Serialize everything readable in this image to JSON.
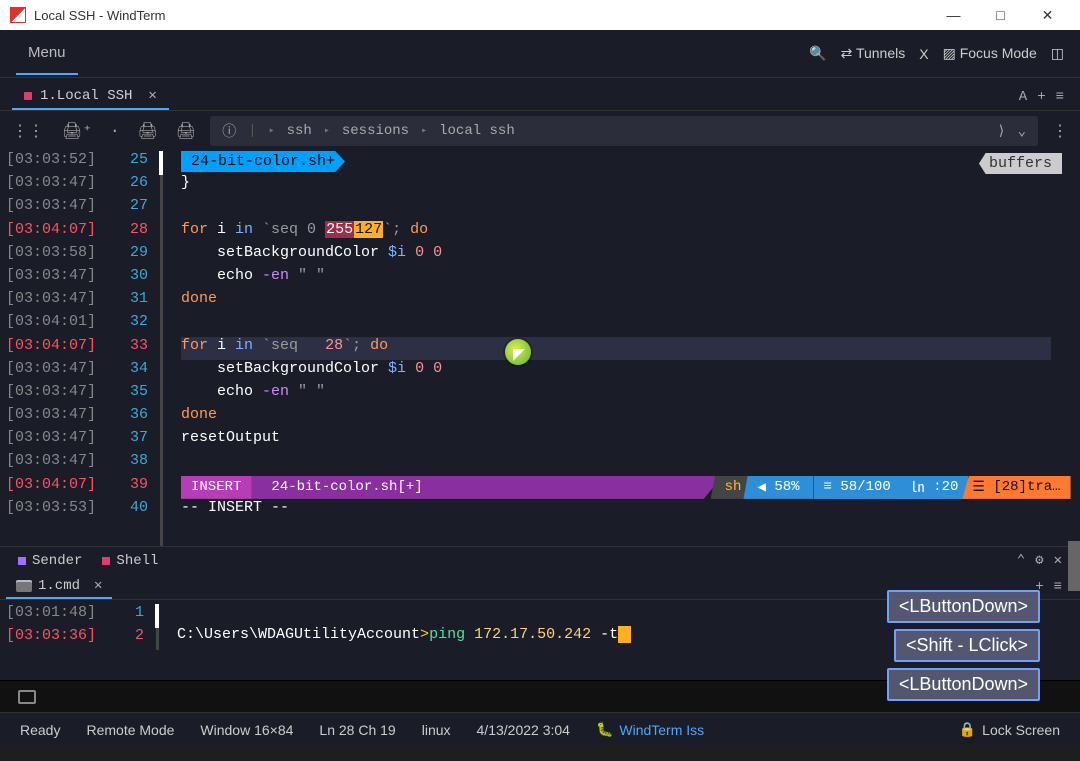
{
  "window": {
    "title": "Local SSH - WindTerm"
  },
  "menu": {
    "label": "Menu",
    "tunnels": "Tunnels",
    "x": "X",
    "focus": "Focus Mode"
  },
  "tab": {
    "label": "1.Local SSH",
    "aa": "A",
    "plus": "+",
    "menu": "≡"
  },
  "breadcrumb": {
    "a": "ssh",
    "b": "sessions",
    "c": "local ssh"
  },
  "filepill": "24-bit-color.sh+",
  "buffers": "buffers",
  "times": [
    "[03:03:52]",
    "[03:03:47]",
    "[03:03:47]",
    "[03:04:07]",
    "[03:03:58]",
    "[03:03:47]",
    "[03:03:47]",
    "[03:04:01]",
    "[03:04:07]",
    "[03:03:47]",
    "[03:03:47]",
    "[03:03:47]",
    "[03:03:47]",
    "[03:03:47]",
    "[03:04:07]",
    "[03:03:53]"
  ],
  "lnums": [
    "25",
    "26",
    "27",
    "28",
    "29",
    "30",
    "31",
    "32",
    "33",
    "34",
    "35",
    "36",
    "37",
    "38",
    "39",
    "40"
  ],
  "code": {
    "l26": "}",
    "l28_pre": "for",
    "l28_i": " i ",
    "l28_in": "in",
    "l28_seq": " `seq 0 ",
    "l28_old": "255",
    "l28_new": "127",
    "l28_post": "`; ",
    "l28_do": "do",
    "l29": "    setBackgroundColor ",
    "l29_var": "$i ",
    "l29_nums": "0 0",
    "l30": "    echo ",
    "l30_flag": "-en",
    "l30_str": " \" \"",
    "l31": "done",
    "l33_pre": "for",
    "l33_i": " i ",
    "l33_in": "in",
    "l33_seq": " `seq   ",
    "l33_num": "28",
    "l33_post": "`; ",
    "l33_do": "do",
    "l34": "    setBackgroundColor ",
    "l34_var": "$i ",
    "l34_nums": "0 0",
    "l35": "    echo ",
    "l35_flag": "-en",
    "l35_str": " \" \"",
    "l36": "done",
    "l37": "resetOutput",
    "l40": "-- INSERT --"
  },
  "statusline": {
    "insert": "INSERT",
    "file": "24-bit-color.sh[+]",
    "lang": "sh",
    "pct": "58%",
    "ratio": "58/100",
    "col": ":20",
    "trail": "[28]tra…"
  },
  "panels": {
    "sender": "Sender",
    "shell": "Shell"
  },
  "subtab": {
    "label": "1.cmd"
  },
  "shell": {
    "times": [
      "[03:01:48]",
      "[03:03:36]"
    ],
    "lnums": [
      "1",
      "2"
    ],
    "path": "C:\\Users\\WDAGUtilityAccount",
    "sep": ">",
    "cmd": "ping ",
    "ip": "172.17.50.242 ",
    "flag": "-t"
  },
  "keys": [
    "<LButtonDown>",
    "<Shift - LClick>",
    "<LButtonDown>"
  ],
  "statusbar": {
    "ready": "Ready",
    "remote": "Remote Mode",
    "win": "Window 16×84",
    "pos": "Ln 28 Ch 19",
    "os": "linux",
    "date": "4/13/2022 3:04",
    "link": "WindTerm Iss",
    "lock": "Lock Screen"
  }
}
